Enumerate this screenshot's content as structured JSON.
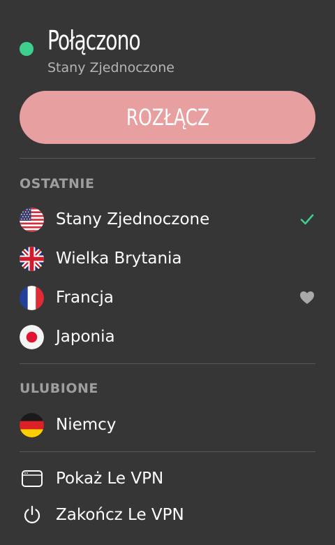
{
  "status": {
    "title": "Połączono",
    "subtitle": "Stany Zjednoczone",
    "dot_color": "#3ecf8e"
  },
  "disconnect": {
    "label": "ROZŁĄCZ",
    "color": "#e79fa0"
  },
  "recent": {
    "heading": "OSTATNIE",
    "items": [
      {
        "label": "Stany Zjednoczone",
        "flag": "us-flag-icon",
        "trail": "checkmark-icon"
      },
      {
        "label": "Wielka Brytania",
        "flag": "uk-flag-icon",
        "trail": ""
      },
      {
        "label": "Francja",
        "flag": "france-flag-icon",
        "trail": "heart-icon"
      },
      {
        "label": "Japonia",
        "flag": "japan-flag-icon",
        "trail": ""
      }
    ]
  },
  "favorites": {
    "heading": "ULUBIONE",
    "items": [
      {
        "label": "Niemcy",
        "flag": "germany-flag-icon"
      }
    ]
  },
  "menu": {
    "show_label": "Pokaż Le VPN",
    "show_icon": "window-icon",
    "quit_label": "Zakończ Le VPN",
    "quit_icon": "power-icon"
  },
  "colors": {
    "background": "#363636",
    "accent_green": "#3ecf8e",
    "muted_text": "#9e9e9e"
  }
}
